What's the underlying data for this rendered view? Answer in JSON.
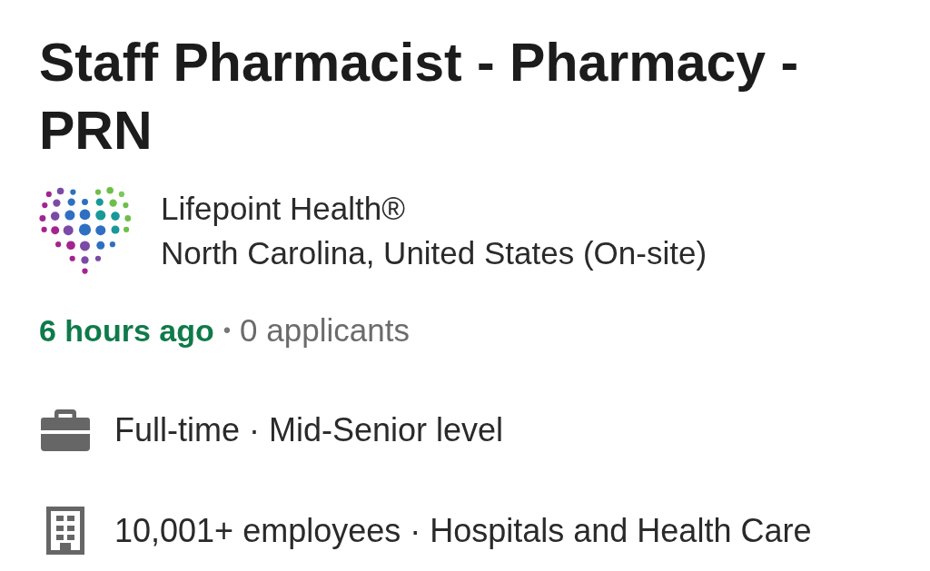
{
  "job": {
    "title": "Staff Pharmacist - Pharmacy - PRN"
  },
  "company": {
    "name": "Lifepoint Health®",
    "location": "North Carolina, United States (On-site)"
  },
  "activity": {
    "posted": "6 hours ago",
    "separator": "•",
    "applicants": "0 applicants"
  },
  "insights": [
    {
      "kind": "job-type",
      "text": "Full-time · Mid-Senior level"
    },
    {
      "kind": "company-size",
      "text": "10,001+ employees · Hospitals and Health Care"
    }
  ]
}
